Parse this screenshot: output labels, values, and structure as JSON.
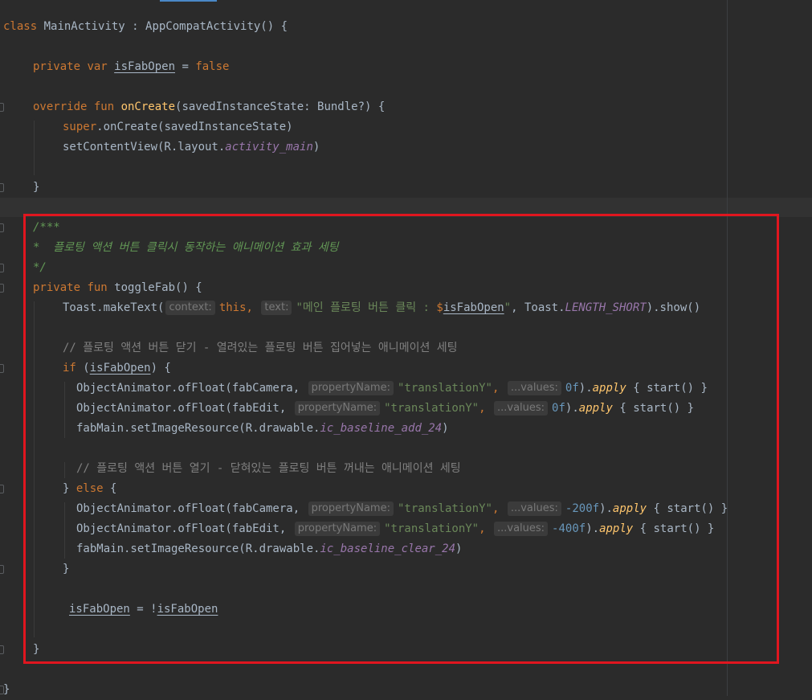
{
  "editor": {
    "theme_colors": {
      "background": "#2b2b2b",
      "keyword": "#cc7832",
      "function": "#ffc66d",
      "string": "#6a8759",
      "number": "#6897bb",
      "comment": "#808080",
      "doc_comment": "#629755",
      "property": "#9876aa",
      "text": "#a9b7c6",
      "hint_background": "#3b3b3b",
      "highlight_border": "#e0161f"
    },
    "hints": {
      "context": "context:",
      "text": "text:",
      "property_name": "propertyName:",
      "values": "...values:"
    },
    "line1": {
      "kw": "class",
      "name": " MainActivity : AppCompatActivity() {"
    },
    "line2": {
      "kw1": "private ",
      "kw2": "var ",
      "var": "isFabOpen",
      "eq": " = ",
      "val": "false"
    },
    "line3": {
      "kw1": "override ",
      "kw2": "fun ",
      "fn": "onCreate",
      "rest": "(savedInstanceState: Bundle?) {"
    },
    "line4": {
      "kw": "super",
      "rest": ".onCreate(savedInstanceState)"
    },
    "line5": {
      "pre": "setContentView(R.layout.",
      "prop": "activity_main",
      "post": ")"
    },
    "line6": {
      "brace": "}"
    },
    "line7": {
      "doc": "/***"
    },
    "line8": {
      "doc": "*  플로팅 액션 버튼 클릭시 동작하는 애니메이션 효과 세팅"
    },
    "line9": {
      "doc": "*/"
    },
    "line10": {
      "kw1": "private ",
      "kw2": "fun ",
      "name": "toggleFab",
      "rest": "() {"
    },
    "line11": {
      "pre": "Toast.makeText(",
      "this": "this",
      "comma": ", ",
      "str1": "\"메인 플로팅 버튼 클릭 : ",
      "dollar": "$",
      "var": "isFabOpen",
      "str2": "\"",
      "post": ", Toast.",
      "prop": "LENGTH_SHORT",
      "end": ").show()"
    },
    "line12": {
      "cmt": "// 플로팅 액션 버튼 닫기 - 열려있는 플로팅 버튼 집어넣는 애니메이션 세팅"
    },
    "line13": {
      "kw": "if",
      "open": " (",
      "var": "isFabOpen",
      "close": ") {"
    },
    "line14": {
      "pre": "ObjectAnimator.ofFloat(fabCamera, ",
      "str": "\"translationY\"",
      "comma": ", ",
      "num": "0f",
      "post": ").",
      "apply": "apply",
      "end": " { start() }"
    },
    "line15": {
      "pre": "ObjectAnimator.ofFloat(fabEdit, ",
      "str": "\"translationY\"",
      "comma": ", ",
      "num": "0f",
      "post": ").",
      "apply": "apply",
      "end": " { start() }"
    },
    "line16": {
      "pre": "fabMain.setImageResource(R.drawable.",
      "prop": "ic_baseline_add_24",
      "post": ")"
    },
    "line17": {
      "cmt": "// 플로팅 액션 버튼 열기 - 닫혀있는 플로팅 버튼 꺼내는 애니메이션 세팅"
    },
    "line18": {
      "close": "} ",
      "kw": "else",
      "open": " {"
    },
    "line19": {
      "pre": "ObjectAnimator.ofFloat(fabCamera, ",
      "str": "\"translationY\"",
      "comma": ", ",
      "num": "-200f",
      "post": ").",
      "apply": "apply",
      "end": " { start() }"
    },
    "line20": {
      "pre": "ObjectAnimator.ofFloat(fabEdit, ",
      "str": "\"translationY\"",
      "comma": ", ",
      "num": "-400f",
      "post": ").",
      "apply": "apply",
      "end": " { start() }"
    },
    "line21": {
      "pre": "fabMain.setImageResource(R.drawable.",
      "prop": "ic_baseline_clear_24",
      "post": ")"
    },
    "line22": {
      "brace": "}"
    },
    "line23": {
      "var1": "isFabOpen",
      "mid": " = !",
      "var2": "isFabOpen"
    },
    "line24": {
      "brace": "}"
    },
    "line25": {
      "brace": "}"
    }
  }
}
